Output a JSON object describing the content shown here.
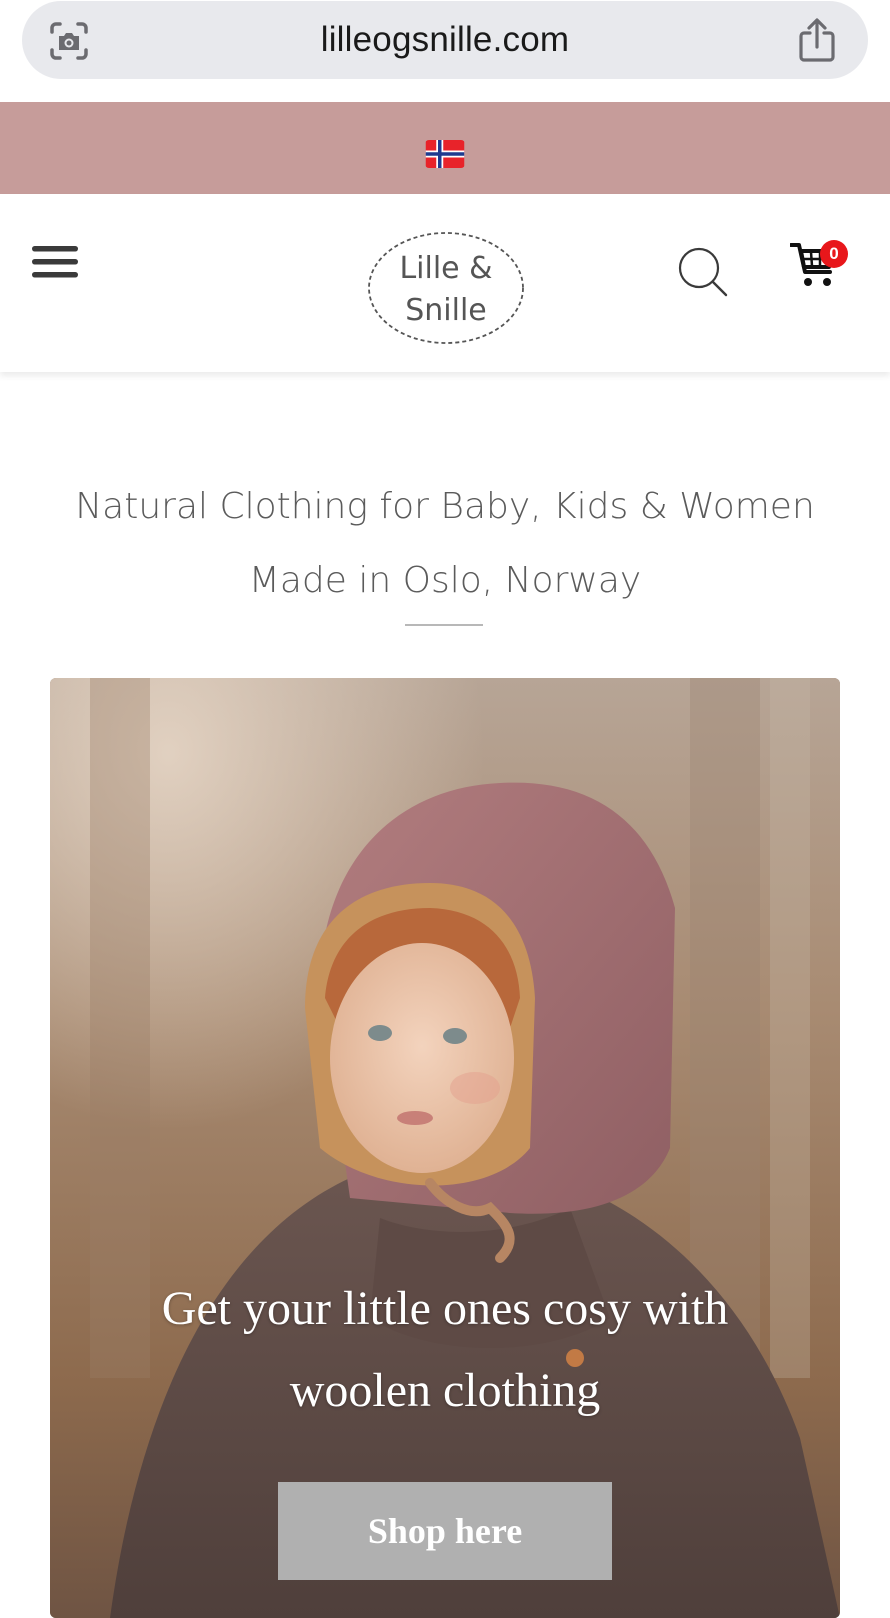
{
  "browser": {
    "url": "lilleogsnille.com",
    "lens_icon": "visual-lookup-icon",
    "share_icon": "share-icon"
  },
  "top_bar": {
    "flag": "norway-flag",
    "background": "#c69c9a"
  },
  "header": {
    "menu_icon": "hamburger-menu-icon",
    "logo": {
      "line1": "Lille &",
      "line2": "Snille"
    },
    "search_icon": "search-icon",
    "cart": {
      "icon": "shopping-cart-icon",
      "count": "0",
      "badge_color": "#e8171b"
    }
  },
  "tagline": {
    "line1": "Natural Clothing for Baby, Kids & Women",
    "line2": "Made in Oslo, Norway"
  },
  "hero": {
    "headline_line1": "Get your little ones cosy with",
    "headline_line2": "woolen clothing",
    "button_label": "Shop here"
  }
}
